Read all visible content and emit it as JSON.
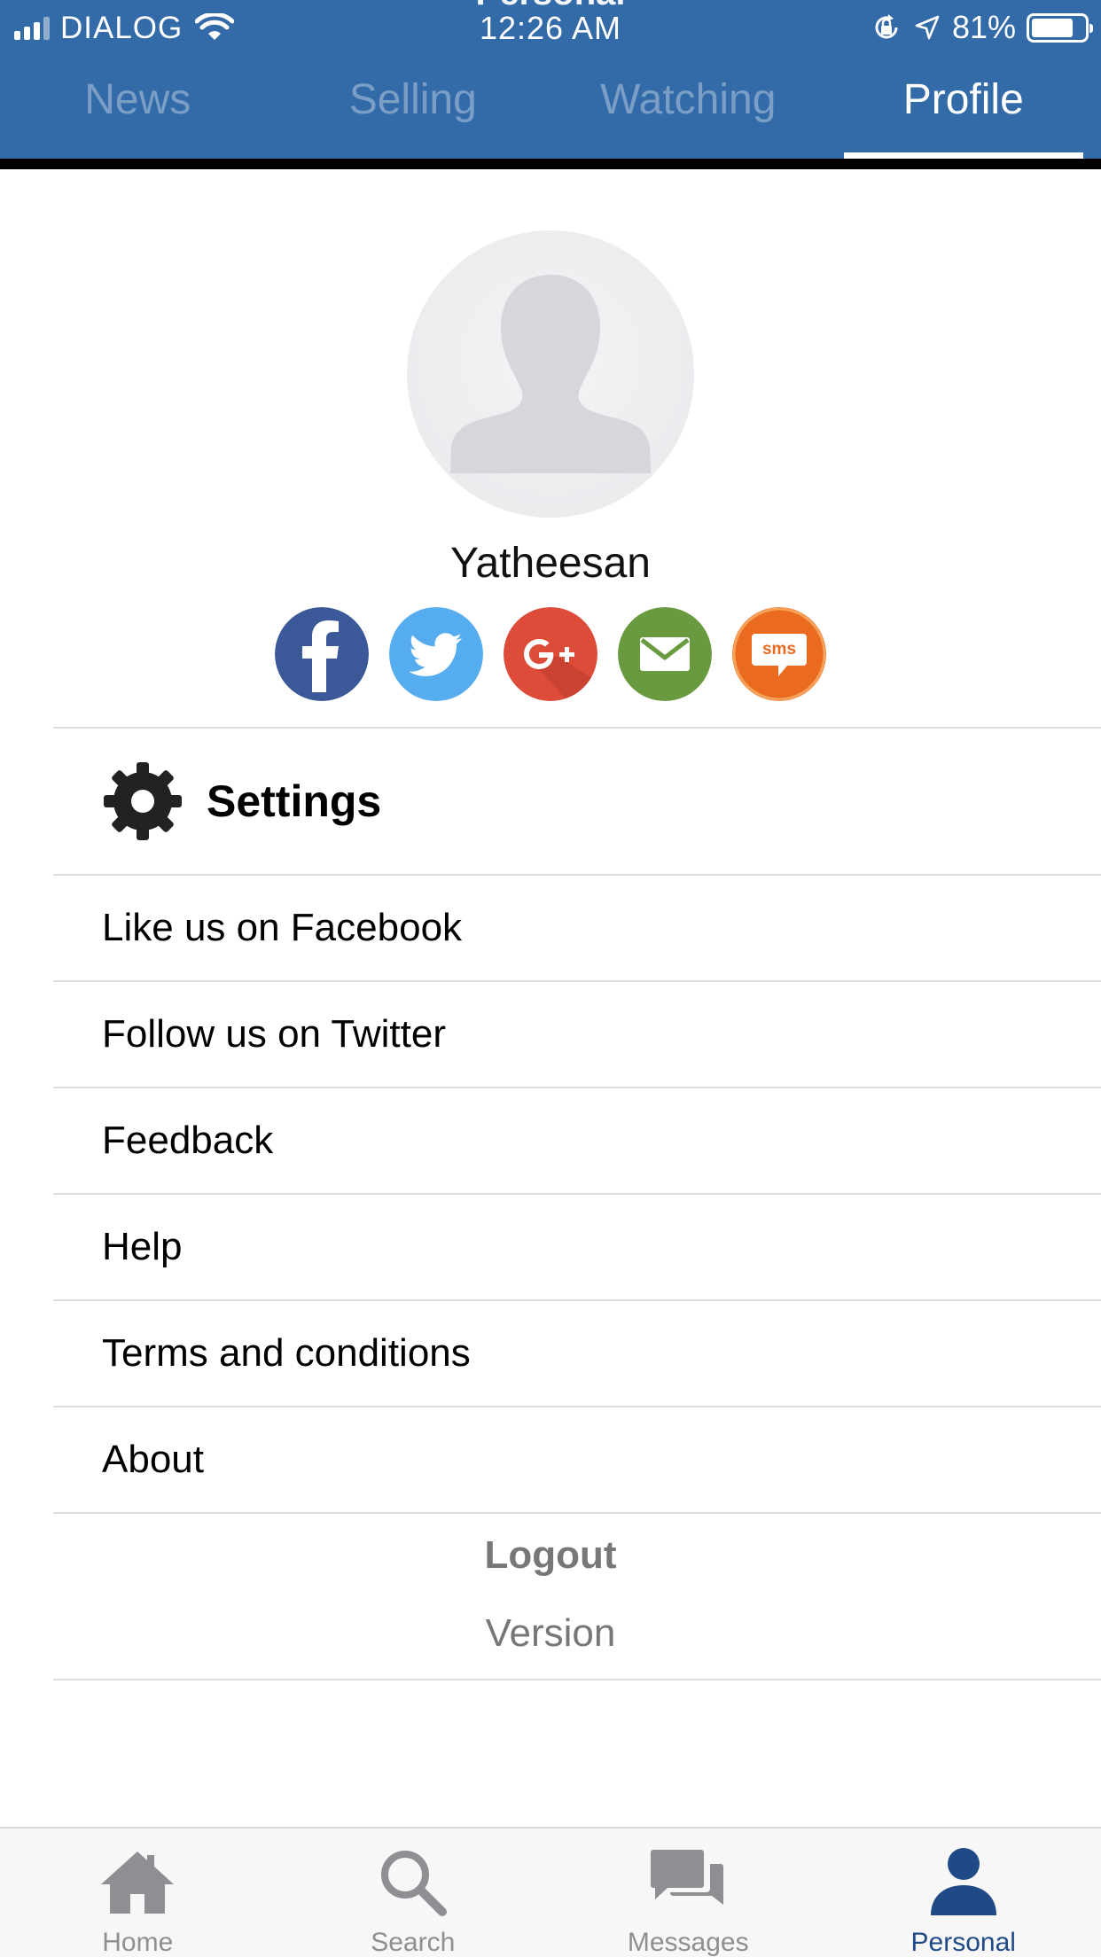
{
  "status_bar": {
    "carrier": "DIALOG",
    "time": "12:26 AM",
    "battery_percent": "81%",
    "battery_level": 0.81,
    "icons": [
      "signal-icon",
      "wifi-icon",
      "orientation-lock-icon",
      "location-arrow-icon",
      "battery-icon"
    ]
  },
  "header": {
    "title": "Personal",
    "tabs": [
      {
        "label": "News",
        "active": false
      },
      {
        "label": "Selling",
        "active": false
      },
      {
        "label": "Watching",
        "active": false
      },
      {
        "label": "Profile",
        "active": true
      }
    ],
    "background_color": "#336aa8"
  },
  "profile": {
    "username": "Yatheesan",
    "share_buttons": [
      {
        "icon": "facebook-icon",
        "color": "#3b5998"
      },
      {
        "icon": "twitter-icon",
        "color": "#55acee"
      },
      {
        "icon": "google-plus-icon",
        "color": "#dd4b39"
      },
      {
        "icon": "email-icon",
        "color": "#6a9a3f"
      },
      {
        "icon": "sms-icon",
        "color": "#ea6a1f",
        "label": "sms"
      }
    ]
  },
  "menu": {
    "settings_label": "Settings",
    "items": [
      {
        "label": "Like us on Facebook"
      },
      {
        "label": "Follow us on Twitter"
      },
      {
        "label": "Feedback"
      },
      {
        "label": "Help"
      },
      {
        "label": "Terms and conditions"
      },
      {
        "label": "About"
      }
    ],
    "logout_label": "Logout",
    "version_label": "Version"
  },
  "bottom_nav": {
    "tabs": [
      {
        "label": "Home",
        "icon": "home-icon",
        "active": false
      },
      {
        "label": "Search",
        "icon": "search-icon",
        "active": false
      },
      {
        "label": "Messages",
        "icon": "messages-icon",
        "active": false
      },
      {
        "label": "Personal",
        "icon": "person-icon",
        "active": true
      }
    ],
    "active_color": "#1f4a86",
    "inactive_color": "#8e8e93"
  }
}
